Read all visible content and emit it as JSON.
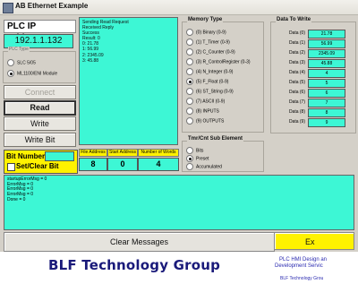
{
  "window": {
    "title": "AB Ethernet Example"
  },
  "plc": {
    "ip_label": "PLC IP Address:",
    "ip_value": "192.1.1.132",
    "type_legend": "PLC Type",
    "type_options": [
      "SLC 5/05",
      "ML1100/ENI Module"
    ],
    "type_selected": "ML1100/ENI Module"
  },
  "buttons": {
    "connect": "Connect",
    "read": "Read",
    "write": "Write",
    "write_bit": "Write Bit",
    "clear": "Clear Messages",
    "exit": "Ex"
  },
  "bit": {
    "number_label": "Bit Number:",
    "set_clear_label": "Set/Clear Bit"
  },
  "response": {
    "lines": [
      "Sending Read Request",
      "Received Reply",
      "Success",
      "Result: 0",
      "0: 21.78",
      "1: 56.99",
      "2: 2345.09",
      "3: 45.88"
    ]
  },
  "fields": {
    "file_address_label": "File Address",
    "file_address": "8",
    "start_address_label": "Start Address",
    "start_address": "0",
    "num_words_label": "Number of Words",
    "num_words": "4"
  },
  "memory_type": {
    "legend": "Memory Type",
    "items": [
      "(0) Binary (0-9)",
      "(1) T_Timer (0-9)",
      "(2) C_Counter (0-9)",
      "(3) R_ControlRegister (0-3)",
      "(4) N_Integer (0-9)",
      "(5) F_Float (0-9)",
      "(6) ST_String (0-9)",
      "(7) ASCII (0-9)",
      "(8) INPUTS",
      "(9) OUTPUTS"
    ],
    "selected_index": 5
  },
  "tmr_cnt": {
    "legend": "Tmr/Cnt Sub Element",
    "items": [
      "Bits",
      "Preset",
      "Accumulated"
    ],
    "selected_index": 1
  },
  "data_to_write": {
    "legend": "Data To Write",
    "rows": [
      {
        "label": "Data (0)",
        "value": "21.78"
      },
      {
        "label": "Data (1)",
        "value": "56.99"
      },
      {
        "label": "Data (2)",
        "value": "2345.09"
      },
      {
        "label": "Data (3)",
        "value": "45.88"
      },
      {
        "label": "Data (4)",
        "value": "4"
      },
      {
        "label": "Data (5)",
        "value": "5"
      },
      {
        "label": "Data (6)",
        "value": "6"
      },
      {
        "label": "Data (7)",
        "value": "7"
      },
      {
        "label": "Data (8)",
        "value": "8"
      },
      {
        "label": "Data (9)",
        "value": "9"
      }
    ]
  },
  "errors": {
    "lines": [
      "startupErrorMsg = 0",
      "ErrorMsg = 0",
      "ErrorMsg = 0",
      "ErrorMsg = 0",
      "Done = 0"
    ]
  },
  "banner": {
    "logo": "BLF Technology Group",
    "tag1": "PLC HMI Design an",
    "tag2": "Development Servic",
    "tag3": "BLF Technology Grou"
  }
}
